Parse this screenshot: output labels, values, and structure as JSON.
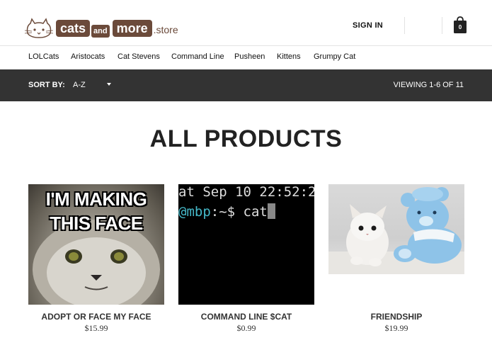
{
  "brand": {
    "name_part1": "cats",
    "name_and": "and",
    "name_part2": "more",
    "name_suffix": ".store",
    "color": "#6b4a3a"
  },
  "header": {
    "signin_label": "SIGN IN",
    "cart_count": "0",
    "cart_icon": "shopping-bag-icon"
  },
  "categories": [
    "LOLCats",
    "Aristocats",
    "Cat Stevens",
    "Command Line",
    "Pusheen",
    "Kittens",
    "Grumpy Cat"
  ],
  "toolbar": {
    "sort_label": "SORT BY:",
    "sort_value": "A-Z",
    "viewing_text": "VIEWING 1-6 OF 11",
    "background": "#333333"
  },
  "page_title": "ALL PRODUCTS",
  "products": [
    {
      "name": "ADOPT OR FACE MY FACE",
      "price": "$15.99",
      "image_text_line1": "I'M MAKING",
      "image_text_line2": "THIS FACE"
    },
    {
      "name": "COMMAND LINE $CAT",
      "price": "$0.99",
      "terminal_line1": "at Sep 10 22:52:2",
      "terminal_host": "@mbp",
      "terminal_prompt": ":~$ cat"
    },
    {
      "name": "FRIENDSHIP",
      "price": "$19.99"
    }
  ]
}
